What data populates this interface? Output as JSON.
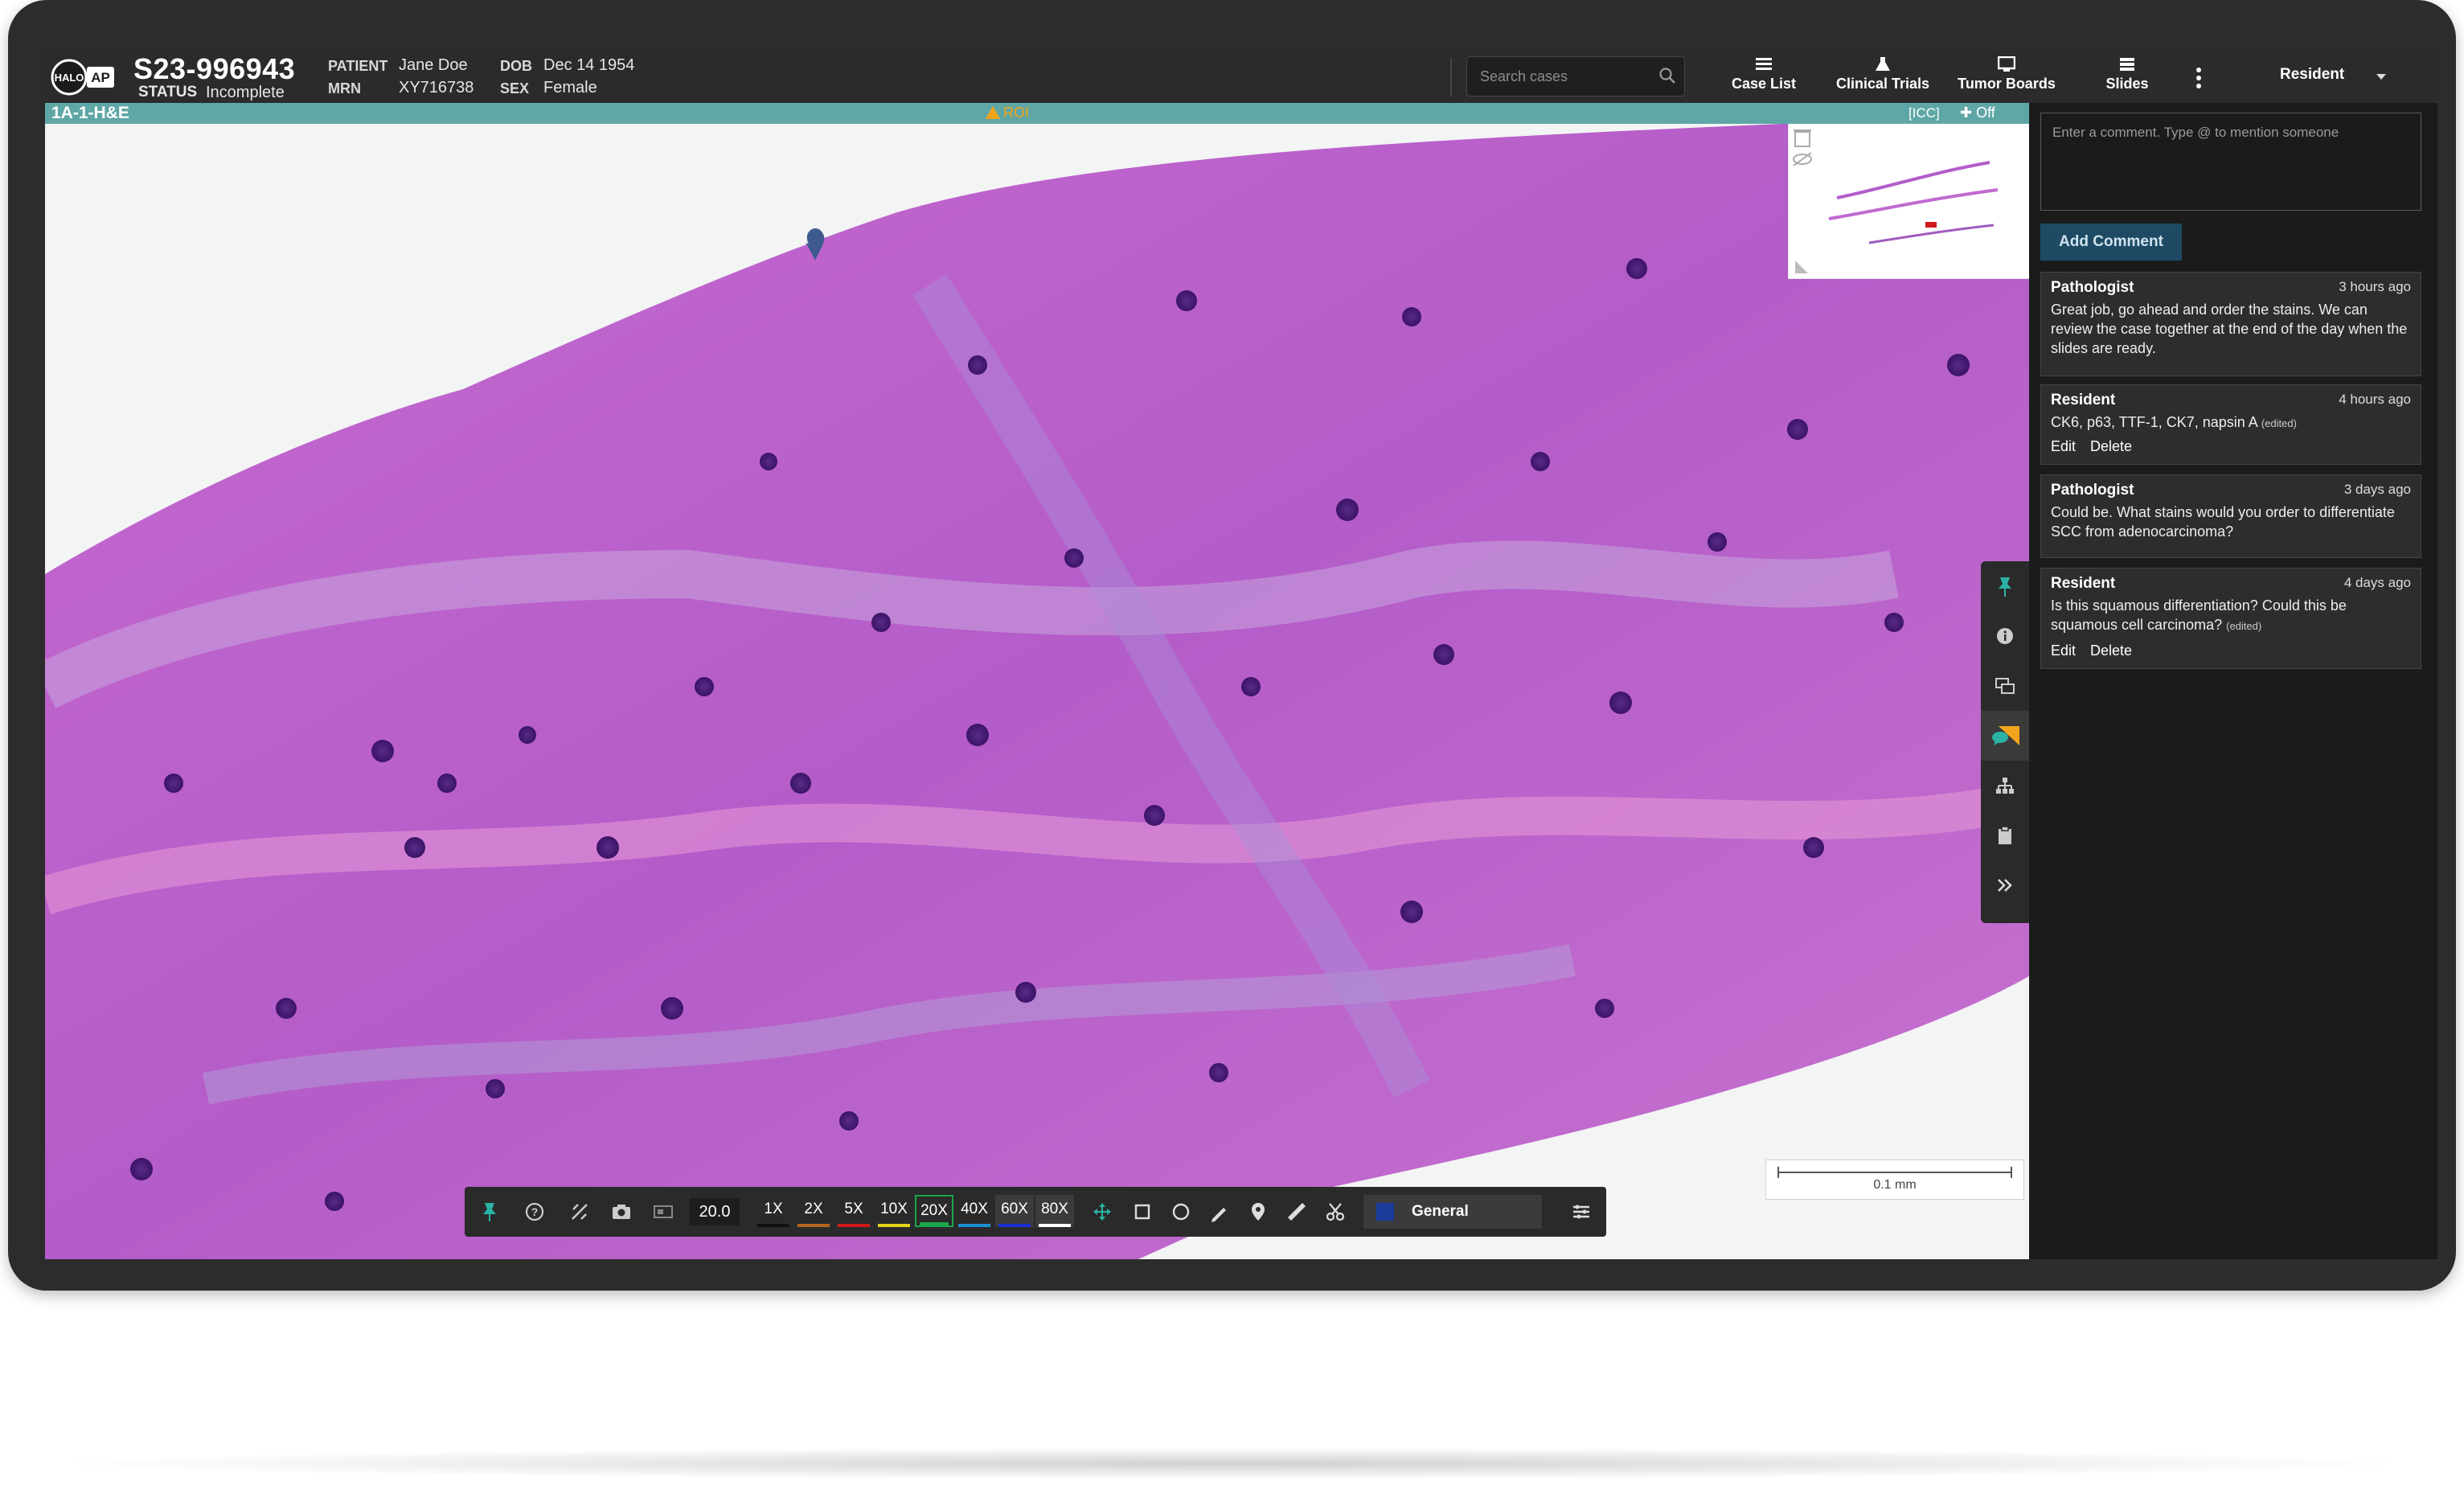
{
  "header": {
    "logo_text": "HALO AP",
    "case_number": "S23-996943",
    "status_label": "STATUS",
    "status_value": "Incomplete",
    "patient_label": "PATIENT",
    "patient_value": "Jane Doe",
    "mrn_label": "MRN",
    "mrn_value": "XY716738",
    "dob_label": "DOB",
    "dob_value": "Dec 14 1954",
    "sex_label": "SEX",
    "sex_value": "Female",
    "search_placeholder": "Search cases",
    "nav": [
      {
        "label": "Case List",
        "icon": "list-icon"
      },
      {
        "label": "Clinical Trials",
        "icon": "flask-icon"
      },
      {
        "label": "Tumor Boards",
        "icon": "monitor-icon"
      },
      {
        "label": "Slides",
        "icon": "slides-icon"
      }
    ],
    "user": "Resident"
  },
  "slide_bar": {
    "slide_name": "1A-1-H&E",
    "roi_label": "ROI",
    "icc_label": "[ICC]",
    "pin_label": "Off"
  },
  "viewer": {
    "scale_label": "0.1 mm"
  },
  "toolbar": {
    "zoom_value": "20.0",
    "zoom_levels": [
      {
        "label": "1X",
        "color": "#111111"
      },
      {
        "label": "2X",
        "color": "#b5651d"
      },
      {
        "label": "5X",
        "color": "#d11a1a"
      },
      {
        "label": "10X",
        "color": "#e8d21a"
      },
      {
        "label": "20X",
        "color": "#1aa64a",
        "active": true
      },
      {
        "label": "40X",
        "color": "#1a8fd1"
      },
      {
        "label": "60X",
        "color": "#1a2fd1",
        "active": true
      },
      {
        "label": "80X",
        "color": "#ffffff",
        "active": true
      }
    ],
    "layer_label": "General",
    "layer_color": "#1a3b9a"
  },
  "comments": {
    "placeholder": "Enter a comment. Type @ to mention someone",
    "add_button": "Add Comment",
    "items": [
      {
        "author": "Pathologist",
        "time": "3 hours ago",
        "body": "Great job, go ahead and order the stains. We can review the case together at the end of the day when the slides are ready.",
        "edited": "",
        "actions": []
      },
      {
        "author": "Resident",
        "time": "4 hours ago",
        "body": "CK6, p63, TTF-1, CK7, napsin A",
        "edited": "(edited)",
        "actions": [
          "Edit",
          "Delete"
        ]
      },
      {
        "author": "Pathologist",
        "time": "3 days ago",
        "body": "Could be. What stains would you order to differentiate SCC from adenocarcinoma?",
        "edited": "",
        "actions": []
      },
      {
        "author": "Resident",
        "time": "4 days ago",
        "body": "Is this squamous differentiation? Could this be squamous cell carcinoma?",
        "edited": "(edited)",
        "actions": [
          "Edit",
          "Delete"
        ]
      }
    ]
  }
}
